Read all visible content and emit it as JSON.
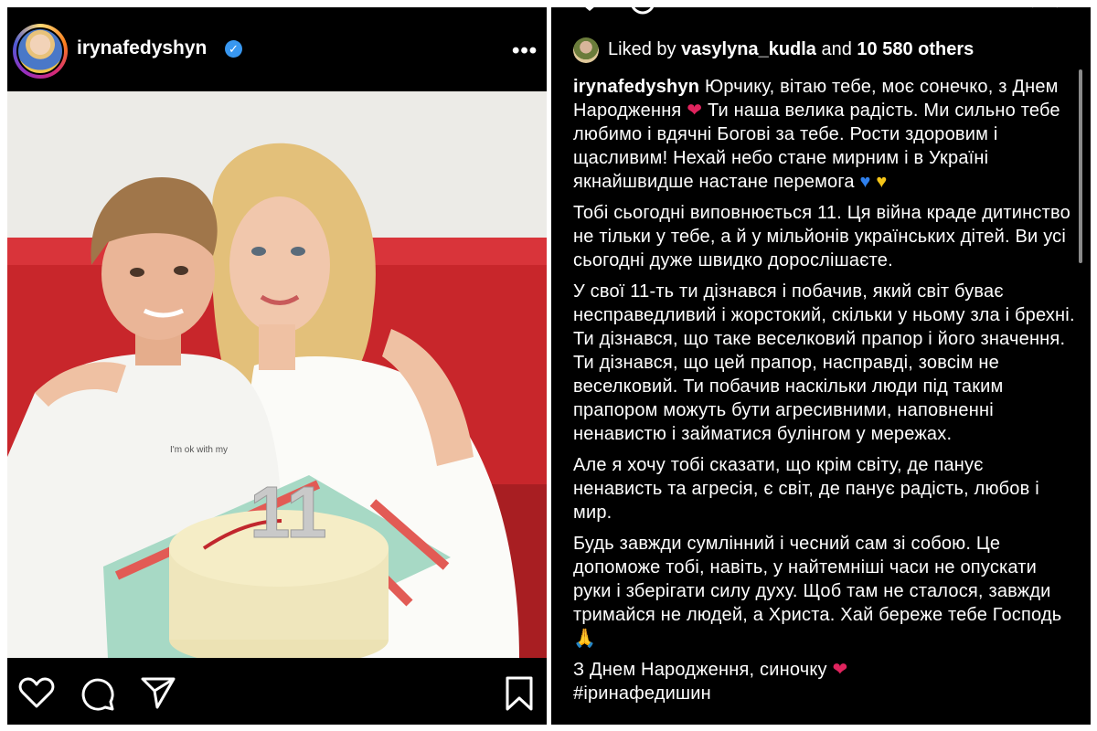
{
  "left_post": {
    "username": "irynafedyshyn",
    "verified_symbol": "✓",
    "more_icon": "more-dots-icon",
    "more_symbol": "•••",
    "photo_shirt_text": "I'm ok with my",
    "cake_candle_number": "11",
    "actions": [
      "heart-icon",
      "comment-icon",
      "share-icon",
      "bookmark-icon"
    ]
  },
  "right_post": {
    "likes": {
      "prefix": "Liked by ",
      "liker": "vasylyna_kudla",
      "middle": " and ",
      "count": "10 580 others"
    },
    "caption": {
      "username": "irynafedyshyn",
      "p1": " Юрчику, вітаю тебе, моє сонечко, з Днем Народження ",
      "p1b": " Ти наша велика радість. Ми сильно тебе любимо і вдячні Богові за тебе. Рости здоровим і щасливим! Нехай небо стане мирним і в Україні якнайшвидше  настане перемога ",
      "p2": "Тобі сьогодні виповнюється 11. Ця війна краде дитинство не тільки у тебе, а й у мільйонів українських дітей. Ви усі сьогодні дуже швидко дорослішаєте.",
      "p3": "У свої 11-ть ти дізнався і побачив, який світ буває несправедливий і жорстокий, скільки у ньому зла і брехні. Ти дізнався, що таке веселковий прапор і його значення. Ти дізнався, що цей прапор, насправді, зовсім не веселковий. Ти побачив наскільки люди під таким прапором можуть бути агресивними, наповненні ненавистю і займатися булінгом у мережах.",
      "p4": "Але я хочу тобі сказати, що крім світу, де панує ненависть та агресія, є світ, де панує радість, любов і мир.",
      "p5": "Будь завжди сумлінний і чесний сам зі собою. Це допоможе тобі, навіть, у найтемніші часи не опускати руки і зберігати силу духу. Щоб там не сталося, завжди тримайся не людей, а Христа. Хай береже тебе Господь ",
      "p6": "З Днем Народження, синочку ",
      "hashtag": "#іринафедишин"
    },
    "emoji": {
      "heart": "❤",
      "blue_heart": "♥",
      "yellow_heart": "♥",
      "pray": "🙏"
    }
  },
  "colors": {
    "panel_bg": "#000000",
    "verified_blue": "#3897f0",
    "heart_red": "#e0245e"
  }
}
